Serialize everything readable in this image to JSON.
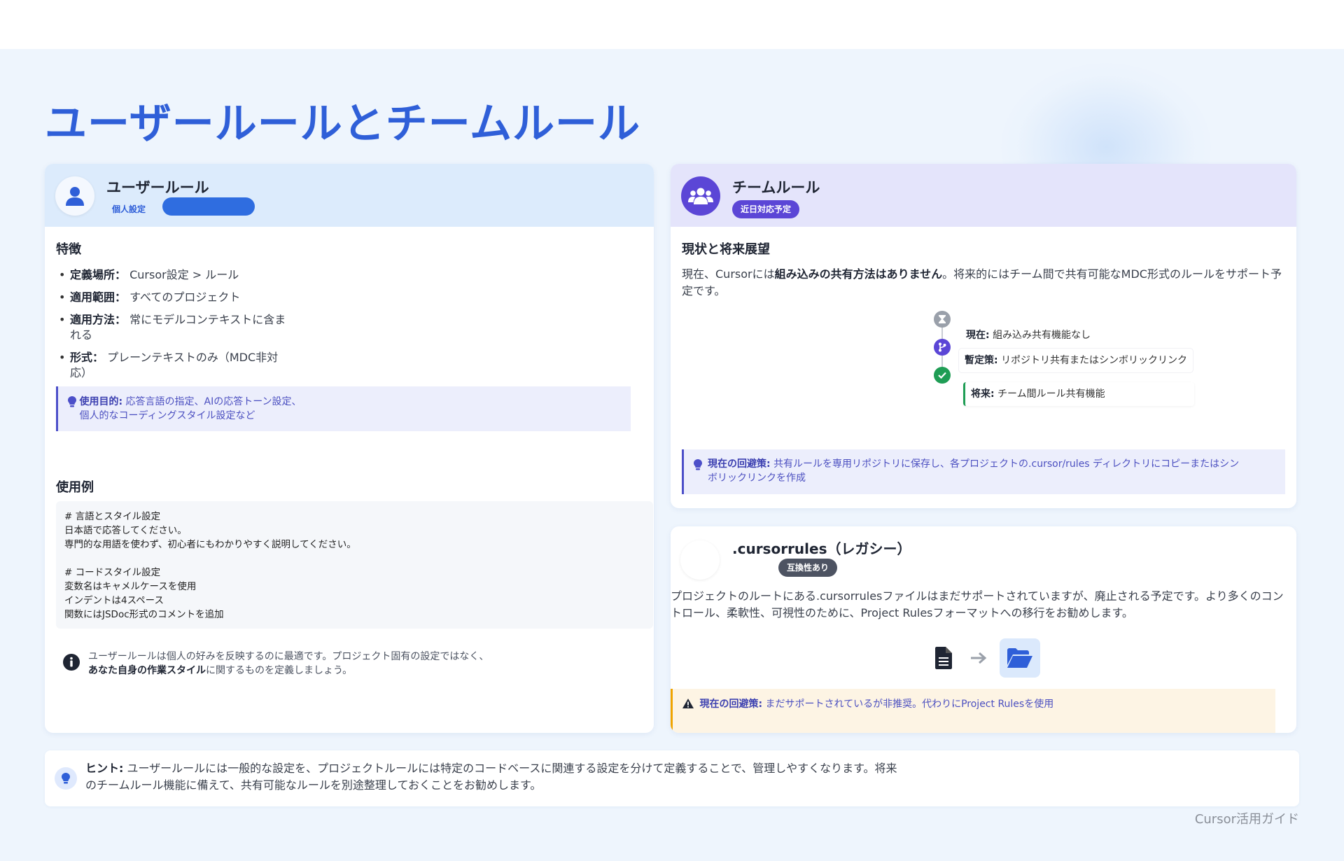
{
  "page": {
    "title": "ユーザールールとチームルール",
    "footer": "Cursor活用ガイド"
  },
  "user_card": {
    "title": "ユーザールール",
    "badge": "個人設定",
    "features_title": "特徴",
    "features": [
      {
        "label": "定義場所：",
        "value": "Cursor設定 > ルール"
      },
      {
        "label": "適用範囲：",
        "value": "すべてのプロジェクト"
      },
      {
        "label": "適用方法：",
        "value": "常にモデルコンテキストに含まれる"
      },
      {
        "label": "形式：",
        "value": "プレーンテキストのみ（MDC非対応）"
      }
    ],
    "purpose_label": "使用目的:",
    "purpose_text": "応答言語の指定、AIの応答トーン設定、個人的なコーディングスタイル設定など",
    "usage_title": "使用例",
    "code": "# 言語とスタイル設定\n日本語で応答してください。\n専門的な用語を使わず、初心者にもわかりやすく説明してください。\n\n# コードスタイル設定\n変数名はキャメルケースを使用\nインデントは4スペース\n関数にはJSDoc形式のコメントを追加",
    "note_text": "ユーザールールは個人の好みを反映するのに最適です。プロジェクト固有の設定ではなく、",
    "note_bold": "あなた自身の作業スタイル",
    "note_tail": "に関するものを定義しましょう。"
  },
  "team_card": {
    "title": "チームルール",
    "badge": "近日対応予定",
    "section_title": "現状と将来展望",
    "desc_pre": "現在、Cursorには",
    "desc_bold": "組み込みの共有方法はありません",
    "desc_post": "。将来的にはチーム間で共有可能なMDC形式のルールをサポート予定です。",
    "timeline": [
      {
        "label": "現在:",
        "text": "組み込み共有機能なし"
      },
      {
        "label": "暫定策:",
        "text": "リポジトリ共有またはシンボリックリンク"
      },
      {
        "label": "将来:",
        "text": "チーム間ルール共有機能"
      }
    ],
    "workaround_label": "現在の回避策:",
    "workaround_text": "共有ルールを専用リポジトリに保存し、各プロジェクトの.cursor/rules ディレクトリにコピーまたはシンボリックリンクを作成"
  },
  "legacy_card": {
    "title": ".cursorrules（レガシー）",
    "badge": "互換性あり",
    "desc": "プロジェクトのルートにある.cursorrulesファイルはまだサポートされていますが、廃止される予定です。より多くのコントロール、柔軟性、可視性のために、Project Rulesフォーマットへの移行をお勧めします。",
    "warn_label": "現在の回避策:",
    "warn_text": "まだサポートされているが非推奨。代わりにProject Rulesを使用"
  },
  "hint": {
    "label": "ヒント:",
    "text": "ユーザールールには一般的な設定を、プロジェクトルールには特定のコードベースに関連する設定を分けて定義することで、管理しやすくなります。将来のチームルール機能に備えて、共有可能なルールを別途整理しておくことをお勧めします。"
  },
  "colors": {
    "accent": "#2f5fd8",
    "team_accent": "#5b46d6",
    "purpose_text": "#4b4fc0",
    "warning": "#f0a400",
    "success": "#1f9d55"
  },
  "icons": [
    "user-icon",
    "users-icon",
    "lightbulb-icon",
    "info-icon",
    "hourglass-icon",
    "branch-icon",
    "check-icon",
    "file-icon",
    "arrow-right-icon",
    "folder-open-icon",
    "warning-icon"
  ]
}
